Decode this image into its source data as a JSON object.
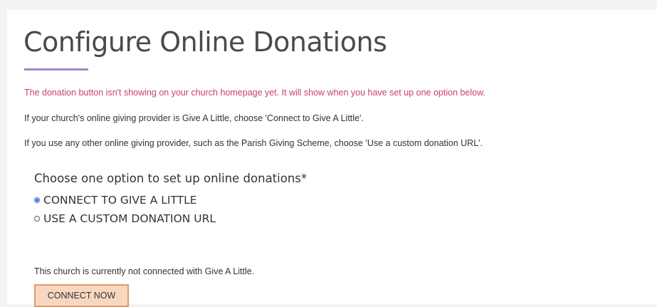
{
  "page": {
    "title": "Configure Online Donations",
    "warning": "The donation button isn't showing on your church homepage yet. It will show when you have set up one option below.",
    "info_give_a_little": "If your church's online giving provider is Give A Little, choose 'Connect to Give A Little'.",
    "info_custom_url": "If you use any other online giving provider, such as the Parish Giving Scheme, choose 'Use a custom donation URL'."
  },
  "options": {
    "legend": "Choose one option to set up online donations*",
    "items": [
      {
        "label": "CONNECT TO GIVE A LITTLE",
        "selected": true
      },
      {
        "label": "USE A CUSTOM DONATION URL",
        "selected": false
      }
    ]
  },
  "connection": {
    "status": "This church is currently not connected with Give A Little.",
    "button_label": "CONNECT NOW"
  },
  "colors": {
    "accent_underline": "#a586c5",
    "warning_text": "#cc3d6d",
    "radio_selected": "#1f5fd1",
    "button_bg": "#f8d7c1",
    "button_border": "#e49a64"
  }
}
